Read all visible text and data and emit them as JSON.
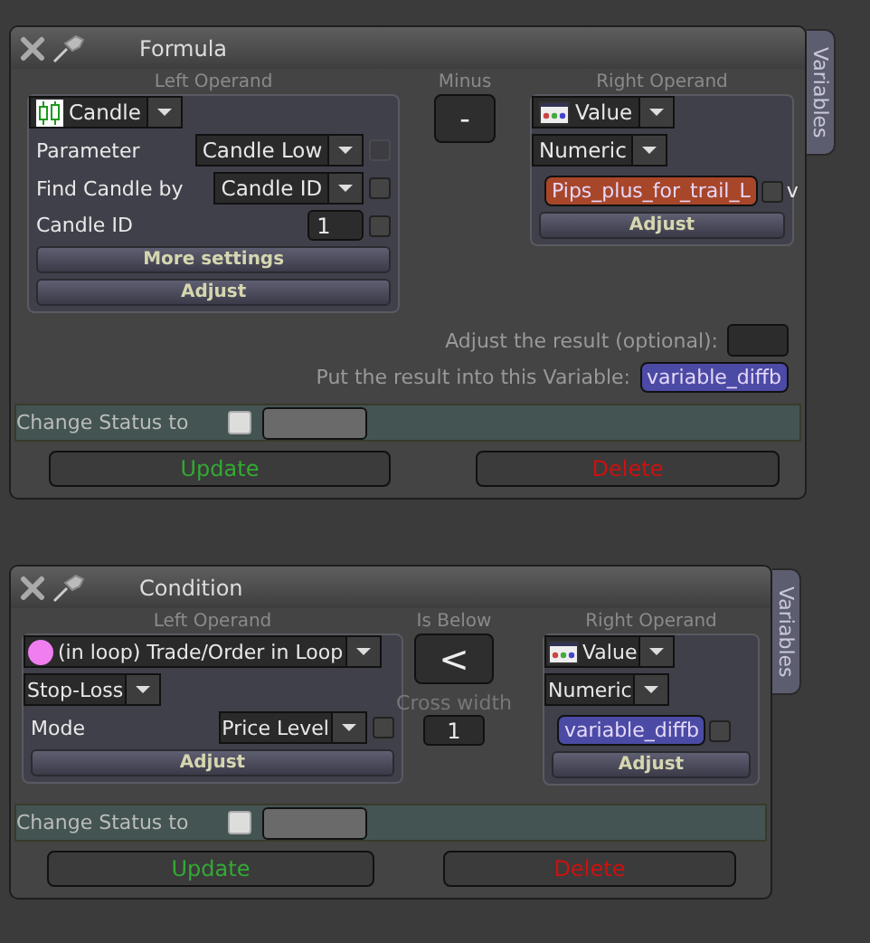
{
  "panels": [
    {
      "title": "Formula",
      "side_tab": "Variables",
      "left_operand": {
        "label": "Left Operand",
        "items": [
          {
            "kind": "candle-source",
            "value": "Candle"
          },
          {
            "kind": "select-row",
            "label": "Parameter",
            "value": "Candle Low",
            "checked": false,
            "disabled": true
          },
          {
            "kind": "select-row",
            "label": "Find Candle by",
            "value": "Candle ID",
            "checked": false,
            "disabled": false
          },
          {
            "kind": "input-row",
            "label": "Candle ID",
            "value": "1",
            "checked": false,
            "disabled": false
          },
          {
            "kind": "button",
            "label": "More settings"
          },
          {
            "kind": "button",
            "label": "Adjust"
          }
        ]
      },
      "operator": {
        "label": "Minus",
        "symbol": "-"
      },
      "right_operand": {
        "label": "Right Operand",
        "items": [
          {
            "kind": "value-source",
            "value": "Value"
          },
          {
            "kind": "select",
            "value": "Numeric"
          },
          {
            "kind": "variable",
            "value": "Pips_plus_for_trail_L",
            "color": "#a8462a",
            "checked": false,
            "suffix": "v"
          },
          {
            "kind": "button",
            "label": "Adjust"
          }
        ]
      },
      "result": [
        {
          "kind": "field",
          "label": "Adjust the result (optional):"
        },
        {
          "kind": "variable",
          "label": "Put the result into this Variable:",
          "value": "variable_diffb",
          "color": "#4b4ba5"
        }
      ],
      "status": {
        "label": "Change Status to",
        "checked": false
      },
      "buttons": [
        {
          "kind": "update",
          "label": "Update"
        },
        {
          "kind": "delete",
          "label": "Delete"
        }
      ]
    },
    {
      "title": "Condition",
      "side_tab": "Variables",
      "left_operand": {
        "label": "Left Operand",
        "items": [
          {
            "kind": "trade-source",
            "value": "(in loop) Trade/Order in Loop"
          },
          {
            "kind": "select",
            "value": "Stop-Loss"
          },
          {
            "kind": "select-row",
            "label": "Mode",
            "value": "Price Level",
            "checked": false,
            "disabled": false
          },
          {
            "kind": "button",
            "label": "Adjust"
          }
        ]
      },
      "operator": {
        "label": "Is Below",
        "symbol": "<"
      },
      "cross_width": {
        "label": "Cross width",
        "value": "1"
      },
      "right_operand": {
        "label": "Right Operand",
        "items": [
          {
            "kind": "value-source",
            "value": "Value"
          },
          {
            "kind": "select",
            "value": "Numeric"
          },
          {
            "kind": "variable",
            "value": "variable_diffb",
            "color": "#4b4ba5",
            "checked": false
          },
          {
            "kind": "button",
            "label": "Adjust"
          }
        ]
      },
      "status": {
        "label": "Change Status to",
        "checked": false
      },
      "buttons": [
        {
          "kind": "update",
          "label": "Update"
        },
        {
          "kind": "delete",
          "label": "Delete"
        }
      ]
    }
  ]
}
